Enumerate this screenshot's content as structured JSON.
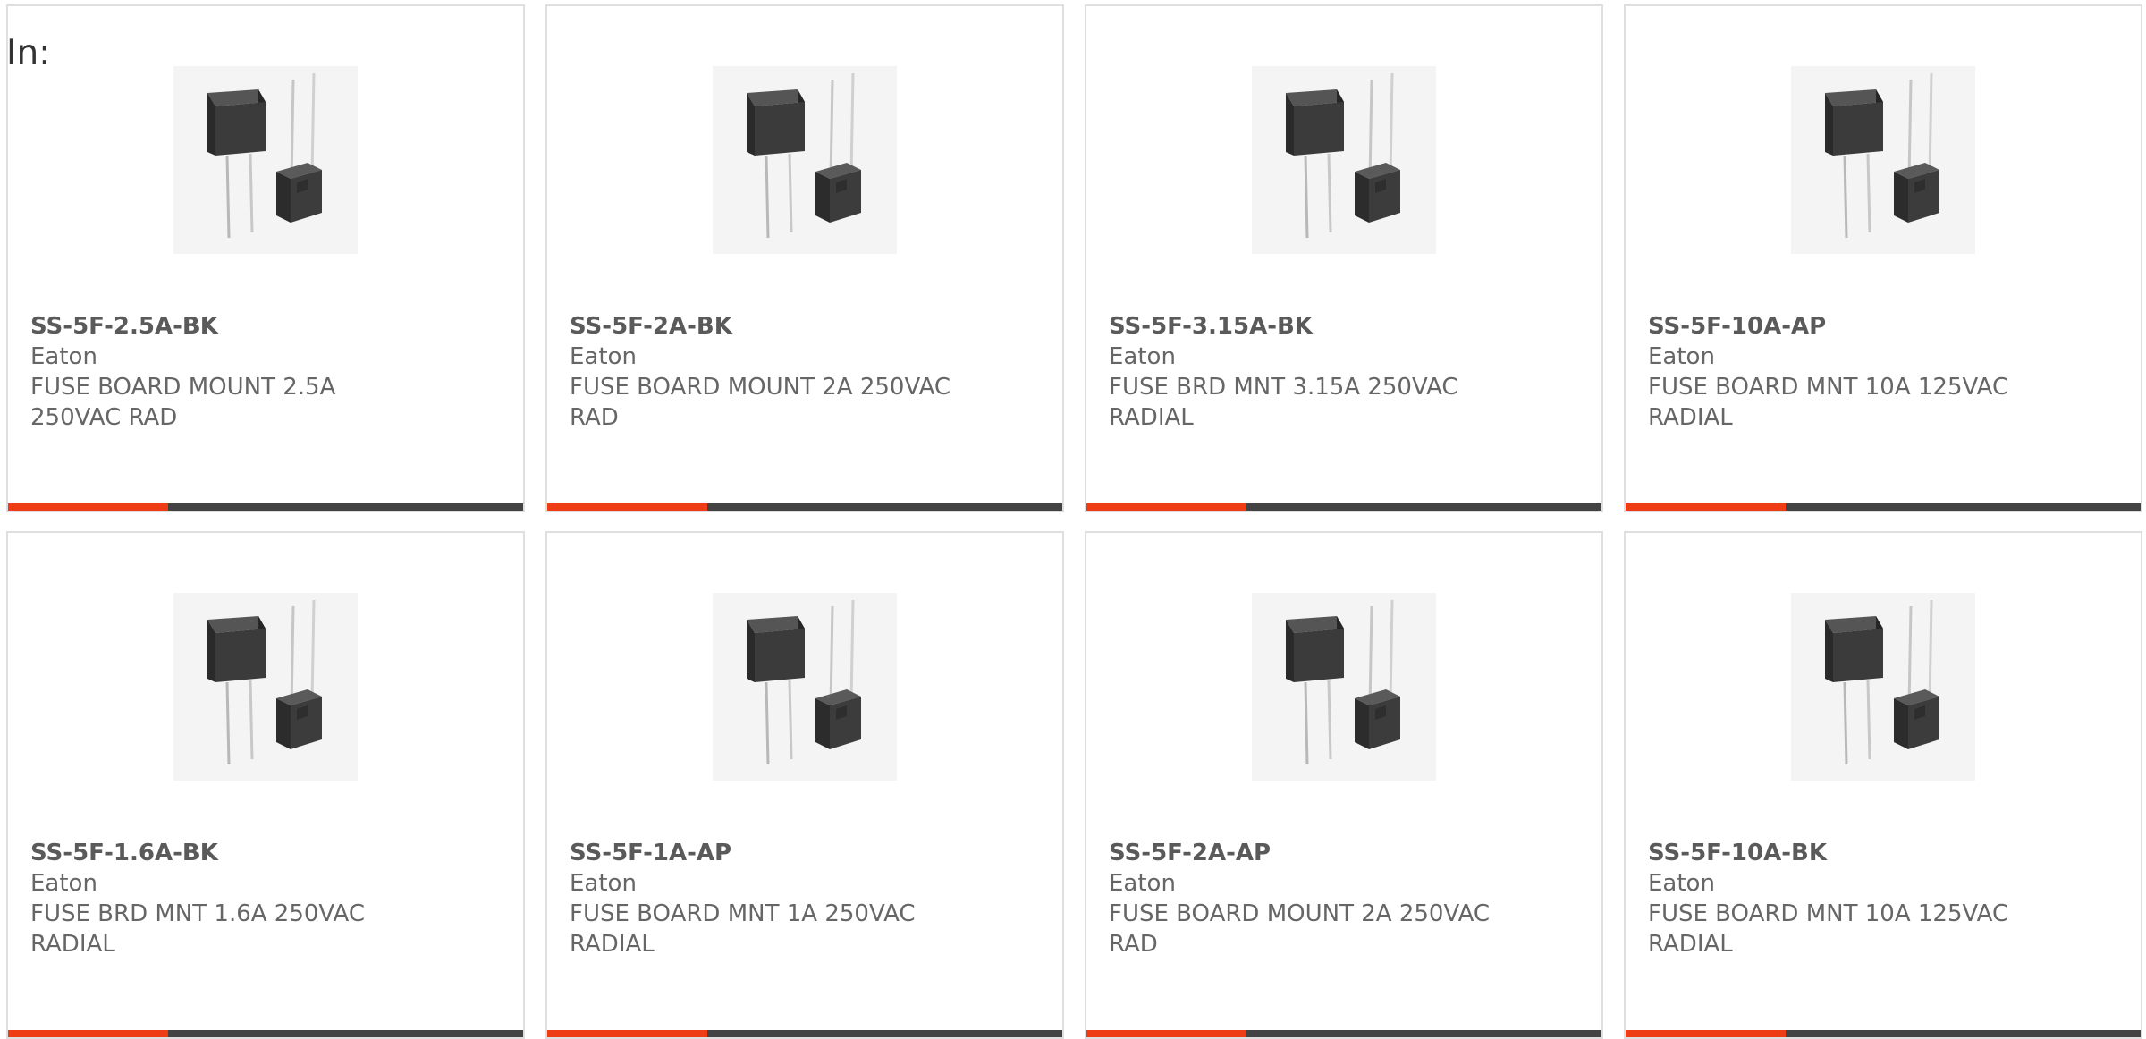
{
  "label_prefix": "In:",
  "colors": {
    "accent": "#ee3c14",
    "bar": "#434343",
    "border": "#dfdfdf"
  },
  "product_image_icon": "fuse-image-icon",
  "accent_level": 0.31,
  "products": [
    {
      "part_number": "SS-5F-2.5A-BK",
      "manufacturer": "Eaton",
      "description": "FUSE BOARD MOUNT 2.5A 250VAC RAD"
    },
    {
      "part_number": "SS-5F-2A-BK",
      "manufacturer": "Eaton",
      "description": "FUSE BOARD MOUNT 2A 250VAC RAD"
    },
    {
      "part_number": "SS-5F-3.15A-BK",
      "manufacturer": "Eaton",
      "description": "FUSE BRD MNT 3.15A 250VAC RADIAL"
    },
    {
      "part_number": "SS-5F-10A-AP",
      "manufacturer": "Eaton",
      "description": "FUSE BOARD MNT 10A 125VAC RADIAL"
    },
    {
      "part_number": "SS-5F-1.6A-BK",
      "manufacturer": "Eaton",
      "description": "FUSE BRD MNT 1.6A 250VAC RADIAL"
    },
    {
      "part_number": "SS-5F-1A-AP",
      "manufacturer": "Eaton",
      "description": "FUSE BOARD MNT 1A 250VAC RADIAL"
    },
    {
      "part_number": "SS-5F-2A-AP",
      "manufacturer": "Eaton",
      "description": "FUSE BOARD MOUNT 2A 250VAC RAD"
    },
    {
      "part_number": "SS-5F-10A-BK",
      "manufacturer": "Eaton",
      "description": "FUSE BOARD MNT 10A 125VAC RADIAL"
    }
  ]
}
